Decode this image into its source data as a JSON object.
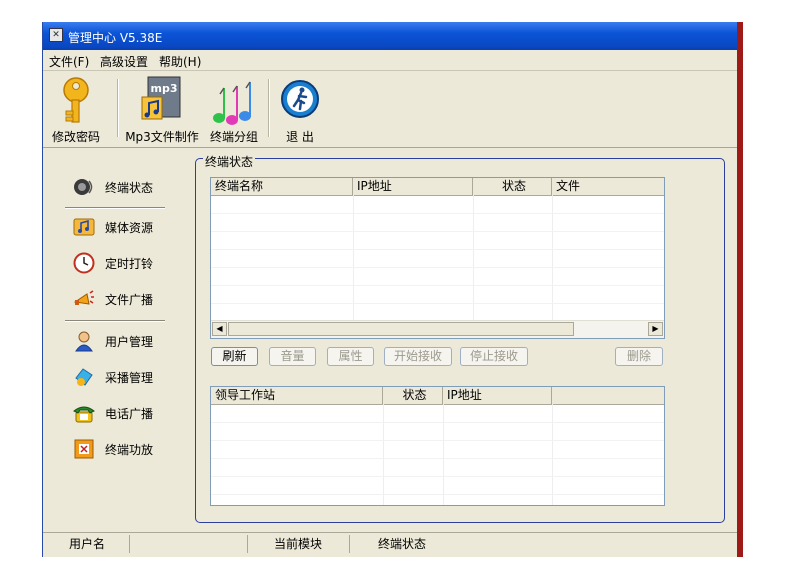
{
  "window": {
    "title": "管理中心 V5.38E",
    "title_icon": "app-icon"
  },
  "menu": [
    "文件(F)",
    "高级设置",
    "帮助(H)"
  ],
  "toolbar": {
    "change_password": "修改密码",
    "mp3_make": "Mp3文件制作",
    "terminal_group": "终端分组",
    "exit": "退 出"
  },
  "nav": {
    "terminal_status": "终端状态",
    "media": "媒体资源",
    "timer_bell": "定时打铃",
    "file_broadcast": "文件广播",
    "user_mgmt": "用户管理",
    "capture_mgmt": "采播管理",
    "phone_broadcast": "电话广播",
    "terminal_amp": "终端功放"
  },
  "group": {
    "title": "终端状态"
  },
  "terminal_table": {
    "columns": [
      "终端名称",
      "IP地址",
      "状态",
      "文件"
    ],
    "rows": []
  },
  "buttons": {
    "refresh": "刷新",
    "volume": "音量",
    "properties": "属性",
    "start_receive": "开始接收",
    "stop_receive": "停止接收",
    "delete": "删除"
  },
  "leader_table": {
    "columns": [
      "领导工作站",
      "状态",
      "IP地址"
    ],
    "rows": []
  },
  "statusbar": {
    "user_label": "用户名",
    "user_value": "",
    "module_label": "当前模块",
    "module_value": "终端状态"
  }
}
